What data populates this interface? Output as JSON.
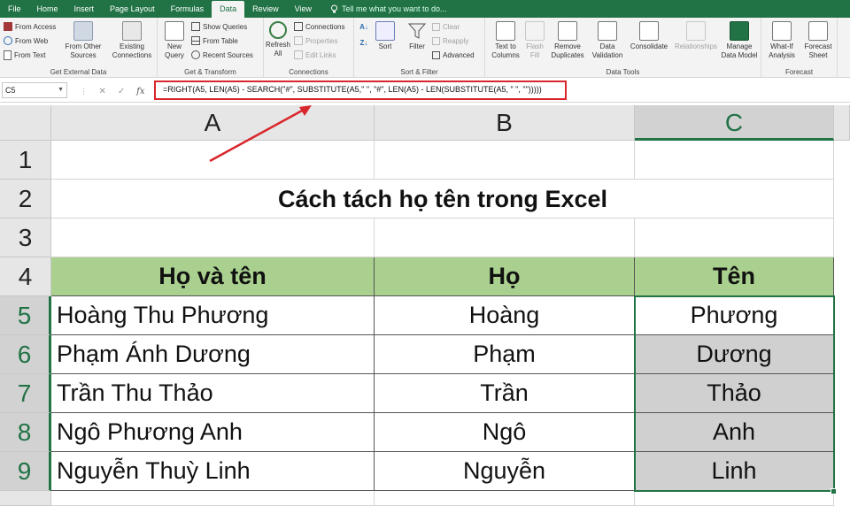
{
  "ribbon_tabs": [
    "File",
    "Home",
    "Insert",
    "Page Layout",
    "Formulas",
    "Data",
    "Review",
    "View"
  ],
  "active_tab": "Data",
  "tell_me": "Tell me what you want to do...",
  "ribbon": {
    "get_external": {
      "label": "Get External Data",
      "from_access": "From Access",
      "from_web": "From Web",
      "from_text": "From Text",
      "from_other_1": "From Other",
      "from_other_2": "Sources",
      "existing_1": "Existing",
      "existing_2": "Connections"
    },
    "get_transform": {
      "label": "Get & Transform",
      "new_query_1": "New",
      "new_query_2": "Query",
      "show_queries": "Show Queries",
      "from_table": "From Table",
      "recent_sources": "Recent Sources"
    },
    "connections": {
      "label": "Connections",
      "refresh_1": "Refresh",
      "refresh_2": "All",
      "connections": "Connections",
      "properties": "Properties",
      "edit_links": "Edit Links"
    },
    "sort_filter": {
      "label": "Sort & Filter",
      "sort": "Sort",
      "filter": "Filter",
      "clear": "Clear",
      "reapply": "Reapply",
      "advanced": "Advanced"
    },
    "data_tools": {
      "label": "Data Tools",
      "text_to_columns_1": "Text to",
      "text_to_columns_2": "Columns",
      "flash_fill_1": "Flash",
      "flash_fill_2": "Fill",
      "remove_dup_1": "Remove",
      "remove_dup_2": "Duplicates",
      "data_val_1": "Data",
      "data_val_2": "Validation",
      "consolidate": "Consolidate",
      "relationships": "Relationships",
      "manage_dm_1": "Manage",
      "manage_dm_2": "Data Model"
    },
    "forecast": {
      "label": "Forecast",
      "whatif_1": "What-If",
      "whatif_2": "Analysis",
      "forecast_1": "Forecast",
      "forecast_2": "Sheet"
    }
  },
  "formula_bar": {
    "name_box": "C5",
    "formula": "=RIGHT(A5, LEN(A5) - SEARCH(\"#\", SUBSTITUTE(A5,\" \", \"#\", LEN(A5) - LEN(SUBSTITUTE(A5, \" \", \"\")))))",
    "fx": "fx"
  },
  "columns": [
    "A",
    "B",
    "C"
  ],
  "rows": [
    "1",
    "2",
    "3",
    "4",
    "5",
    "6",
    "7",
    "8",
    "9"
  ],
  "sheet": {
    "title": "Cách tách họ tên trong Excel",
    "headers": [
      "Họ và tên",
      "Họ",
      "Tên"
    ],
    "data": [
      [
        "Hoàng Thu Phương",
        "Hoàng",
        "Phương"
      ],
      [
        "Phạm Ánh Dương",
        "Phạm",
        "Dương"
      ],
      [
        "Trần Thu Thảo",
        "Trần",
        "Thảo"
      ],
      [
        "Ngô Phương Anh",
        "Ngô",
        "Anh"
      ],
      [
        "Nguyễn Thuỳ Linh",
        "Nguyễn",
        "Linh"
      ]
    ]
  },
  "colors": {
    "excel_green": "#217346",
    "header_fill": "#a9d08e",
    "selection_fill": "#d0d0d0",
    "annotation_red": "#d9262c"
  }
}
